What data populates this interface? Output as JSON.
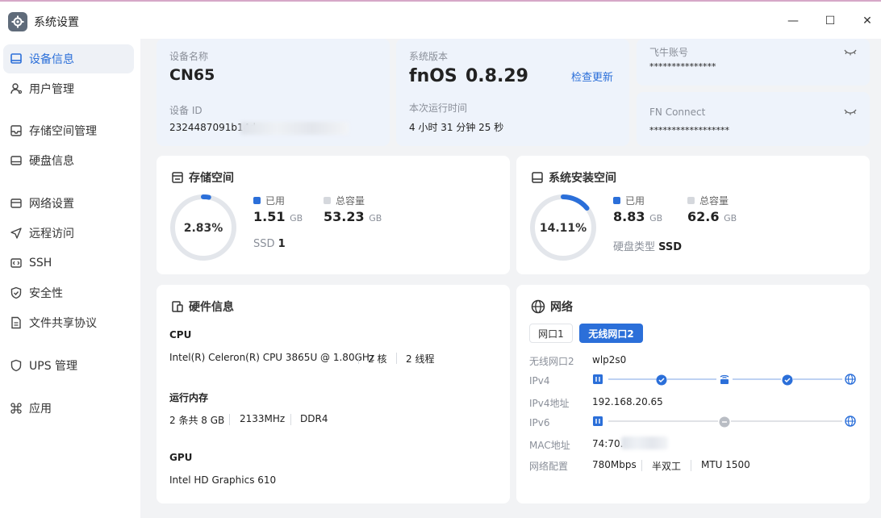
{
  "window": {
    "title": "系统设置",
    "minimize": "—",
    "maximize": "☐",
    "close": "✕"
  },
  "sidebar": {
    "items": [
      {
        "label": "设备信息",
        "icon": "monitor-icon"
      },
      {
        "label": "用户管理",
        "icon": "user-icon"
      },
      {
        "label": "存储空间管理",
        "icon": "storage-icon"
      },
      {
        "label": "硬盘信息",
        "icon": "disk-icon"
      },
      {
        "label": "网络设置",
        "icon": "network-icon"
      },
      {
        "label": "远程访问",
        "icon": "send-icon"
      },
      {
        "label": "SSH",
        "icon": "code-icon"
      },
      {
        "label": "安全性",
        "icon": "shield-check-icon"
      },
      {
        "label": "文件共享协议",
        "icon": "document-icon"
      },
      {
        "label": "UPS 管理",
        "icon": "shield-icon"
      },
      {
        "label": "应用",
        "icon": "command-icon"
      }
    ]
  },
  "device": {
    "name_label": "设备名称",
    "name": "CN65",
    "id_label": "设备 ID",
    "id": "2324487091b14d"
  },
  "system": {
    "version_label": "系统版本",
    "os": "fnOS",
    "version": "0.8.29",
    "check_update": "检查更新",
    "uptime_label": "本次运行时间",
    "uptime": "4 小时 31 分钟 25 秒"
  },
  "accounts": {
    "fn_label": "飞牛账号",
    "fn_value": "***************",
    "connect_label": "FN Connect",
    "connect_value": "******************"
  },
  "storage": {
    "title": "存储空间",
    "percent_text": "2.83%",
    "percent": 2.83,
    "used_label": "已用",
    "used": "1.51",
    "used_unit": "GB",
    "total_label": "总容量",
    "total": "53.23",
    "total_unit": "GB",
    "ssd_label": "SSD",
    "ssd_count": "1"
  },
  "sys_space": {
    "title": "系统安装空间",
    "percent_text": "14.11%",
    "percent": 14.11,
    "used_label": "已用",
    "used": "8.83",
    "used_unit": "GB",
    "total_label": "总容量",
    "total": "62.6",
    "total_unit": "GB",
    "disk_type_label": "硬盘类型",
    "disk_type": "SSD"
  },
  "hardware": {
    "title": "硬件信息",
    "cpu_label": "CPU",
    "cpu": "Intel(R) Celeron(R) CPU 3865U @ 1.80GHz",
    "cores": "2 核",
    "threads": "2 线程",
    "mem_label": "运行内存",
    "mem_size": "2 条共 8 GB",
    "mem_speed": "2133MHz",
    "mem_type": "DDR4",
    "gpu_label": "GPU",
    "gpu": "Intel HD Graphics 610"
  },
  "network": {
    "title": "网络",
    "tabs": [
      {
        "label": "网口1"
      },
      {
        "label": "无线网口2"
      }
    ],
    "iface_label": "无线网口2",
    "iface": "wlp2s0",
    "ipv4_label": "IPv4",
    "ipv4_addr_label": "IPv4地址",
    "ipv4_addr": "192.168.20.65",
    "ipv6_label": "IPv6",
    "mac_label": "MAC地址",
    "mac": "74:70.",
    "config_label": "网络配置",
    "speed": "780Mbps",
    "duplex": "半双工",
    "mtu": "MTU 1500"
  },
  "colors": {
    "accent": "#2b6fd9",
    "ring_bg": "#e3e6eb",
    "inactive_dot": "#d5d8dd"
  }
}
